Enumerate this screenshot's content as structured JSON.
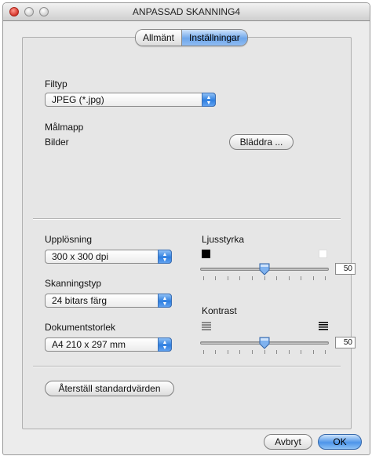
{
  "window": {
    "title": "ANPASSAD SKANNING4"
  },
  "tabs": [
    {
      "label": "Allmänt",
      "active": false
    },
    {
      "label": "Inställningar",
      "active": true
    }
  ],
  "filetype": {
    "label": "Filtyp",
    "value": "JPEG (*.jpg)"
  },
  "destination": {
    "label": "Målmapp",
    "folder": "Bilder",
    "browse_label": "Bläddra ..."
  },
  "resolution": {
    "label": "Upplösning",
    "value": "300 x 300 dpi"
  },
  "scantype": {
    "label": "Skanningstyp",
    "value": "24 bitars färg"
  },
  "docsize": {
    "label": "Dokumentstorlek",
    "value": "A4 210 x 297 mm"
  },
  "brightness": {
    "label": "Ljusstyrka",
    "value": "50",
    "level": 0.5
  },
  "contrast": {
    "label": "Kontrast",
    "value": "50",
    "level": 0.5
  },
  "reset_label": "Återställ standardvärden",
  "footer": {
    "cancel_label": "Avbryt",
    "ok_label": "OK"
  },
  "colors": {
    "accent": "#3d8ae6",
    "window_bg": "#ececec",
    "panel_bg": "#e6e6e6"
  }
}
